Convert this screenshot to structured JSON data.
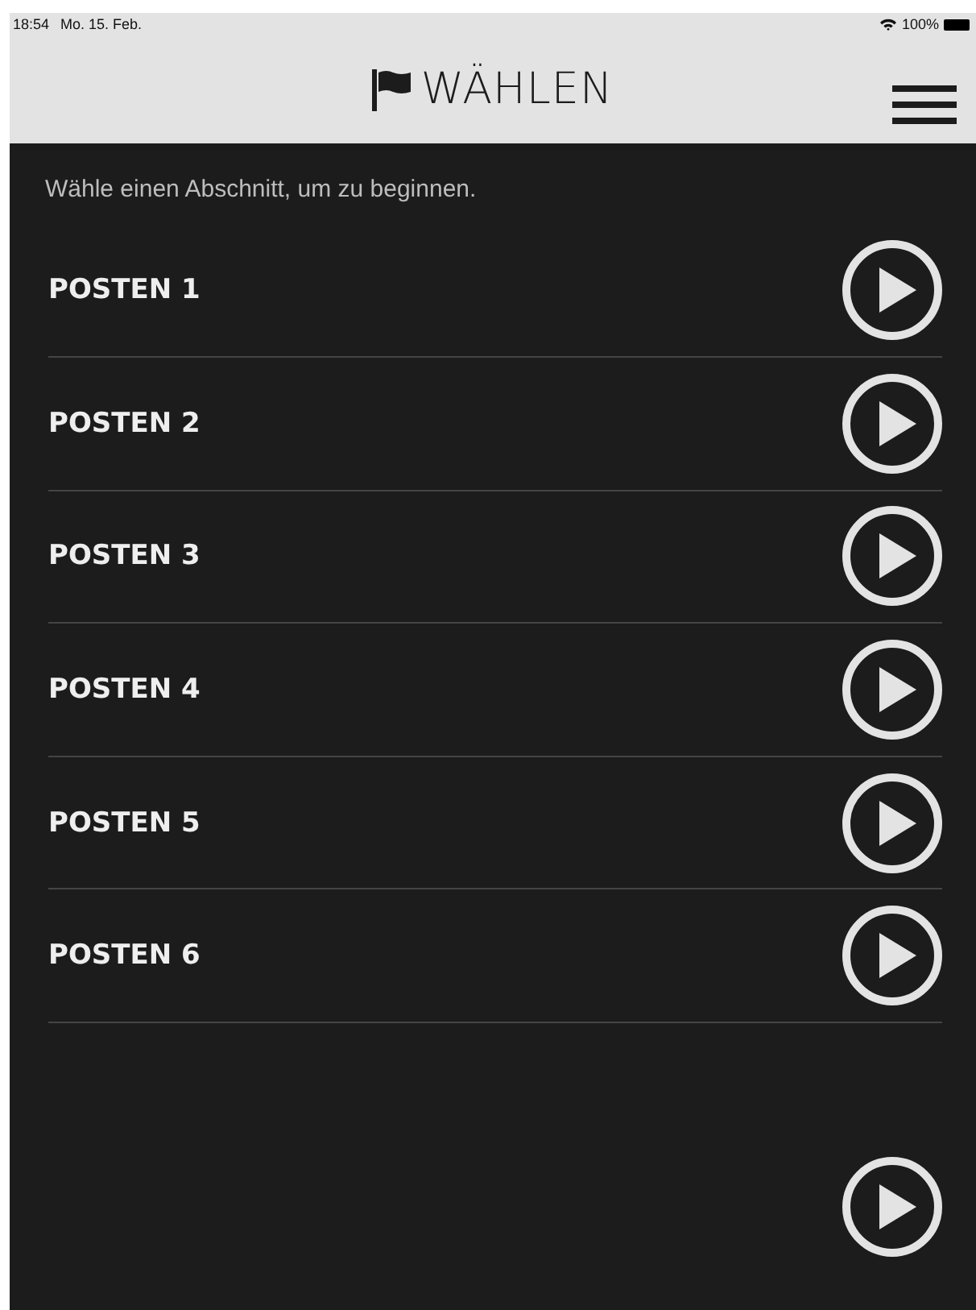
{
  "status_bar": {
    "time": "18:54",
    "date": "Mo. 15. Feb.",
    "battery": "100%"
  },
  "header": {
    "title": "WÄHLEN"
  },
  "intro": "Wähle einen Abschnitt, um zu beginnen.",
  "items": [
    {
      "label": "POSTEN 1"
    },
    {
      "label": "POSTEN 2"
    },
    {
      "label": "POSTEN 3"
    },
    {
      "label": "POSTEN 4"
    },
    {
      "label": "POSTEN 5"
    },
    {
      "label": "POSTEN 6"
    }
  ],
  "more_below": true
}
